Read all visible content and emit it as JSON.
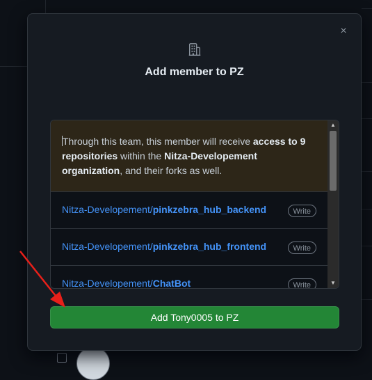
{
  "dialog": {
    "title": "Add member to PZ",
    "close_label": "×",
    "notice": {
      "part1": "Through this team, this member will receive ",
      "bold1": "access to 9 repositories",
      "part2": " within the ",
      "bold2": "Nitza-Developement organization",
      "part3": ", and their forks as well."
    },
    "repositories": [
      {
        "owner": "Nitza-Developement/",
        "name": "pinkzebra_hub_backend",
        "permission": "Write"
      },
      {
        "owner": "Nitza-Developement/",
        "name": "pinkzebra_hub_frontend",
        "permission": "Write"
      },
      {
        "owner": "Nitza-Developement/",
        "name": "ChatBot",
        "permission": "Write"
      }
    ],
    "submit_label": "Add Tony0005 to PZ"
  },
  "colors": {
    "accent_link": "#4493f8",
    "button_green": "#238636",
    "notice_bg": "#2d2618",
    "annotation_arrow": "#e8201a"
  },
  "icons": [
    "organization-icon",
    "close-icon",
    "scroll-up-icon",
    "scroll-down-icon"
  ]
}
